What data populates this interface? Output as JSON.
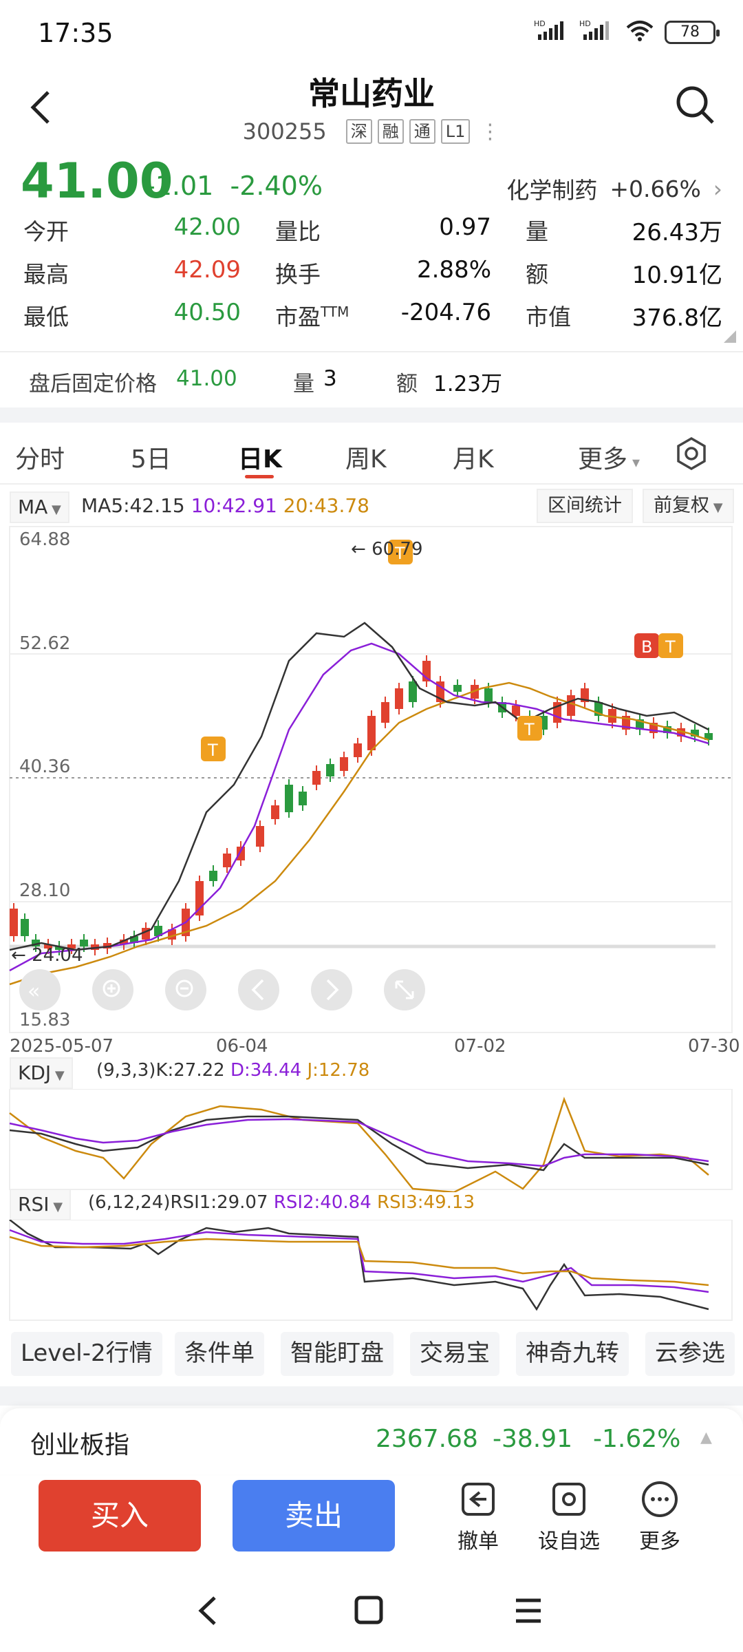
{
  "status": {
    "time": "17:35",
    "battery": "78",
    "hd1": "HD",
    "hd2": "HD"
  },
  "header": {
    "title": "常山药业",
    "code": "300255",
    "tags": [
      "深",
      "融",
      "通",
      "L1"
    ]
  },
  "quote": {
    "price": "41.00",
    "change": "-1.01",
    "change_pct": "-2.40%",
    "sector": "化学制药",
    "sector_pct": "+0.66%",
    "stats": [
      {
        "label": "今开",
        "value": "42.00",
        "color": "green"
      },
      {
        "label": "量比",
        "value": "0.97",
        "color": "dark"
      },
      {
        "label": "量",
        "value": "26.43万",
        "color": "dark"
      },
      {
        "label": "最高",
        "value": "42.09",
        "color": "red"
      },
      {
        "label": "换手",
        "value": "2.88%",
        "color": "dark"
      },
      {
        "label": "额",
        "value": "10.91亿",
        "color": "dark"
      },
      {
        "label": "最低",
        "value": "40.50",
        "color": "green"
      },
      {
        "label": "市盈",
        "value": "-204.76",
        "color": "dark"
      },
      {
        "label": "市值",
        "value": "376.8亿",
        "color": "dark"
      }
    ],
    "pe_sup": "TTM"
  },
  "after_hours": {
    "label": "盘后固定价格",
    "price": "41.00",
    "vol_label": "量",
    "vol": "3",
    "amt_label": "额",
    "amt": "1.23万"
  },
  "tabs": [
    "分时",
    "5日",
    "日K",
    "周K",
    "月K",
    "更多"
  ],
  "ma": {
    "selector": "MA",
    "ma5": "MA5:42.15",
    "ma10": "10:42.91",
    "ma20": "20:43.78",
    "range_btn": "区间统计",
    "adjust_btn": "前复权"
  },
  "kline_axis": {
    "y_labels": [
      "64.88",
      "52.62",
      "40.36",
      "28.10",
      "15.83"
    ],
    "dates": [
      "2025-05-07",
      "06-04",
      "07-02",
      "07-30"
    ],
    "high_mark": "60.79",
    "low_mark": "24.04"
  },
  "markers": [
    "T",
    "T",
    "T",
    "B",
    "T"
  ],
  "kdj": {
    "selector": "KDJ",
    "params": "(9,3,3)K:27.22",
    "d": "D:34.44",
    "j": "J:12.78"
  },
  "rsi": {
    "selector": "RSI",
    "params": "(6,12,24)RSI1:29.07",
    "r2": "RSI2:40.84",
    "r3": "RSI3:49.13"
  },
  "tools": [
    "Level-2行情",
    "条件单",
    "智能盯盘",
    "交易宝",
    "神奇九转",
    "云参选"
  ],
  "index": {
    "name": "创业板指",
    "value": "2367.68",
    "change": "-38.91",
    "pct": "-1.62%"
  },
  "actions": {
    "buy": "买入",
    "sell": "卖出",
    "cancel": "撤单",
    "watch": "设自选",
    "more": "更多"
  },
  "colors": {
    "up": "#e0412f",
    "down": "#2a9a3f",
    "ma5": "#333333",
    "ma10": "#8a1fd8",
    "ma20": "#cc8a0e",
    "sell_btn": "#4a7ef0",
    "buy_btn": "#e0412f",
    "marker": "#f0a020"
  }
}
